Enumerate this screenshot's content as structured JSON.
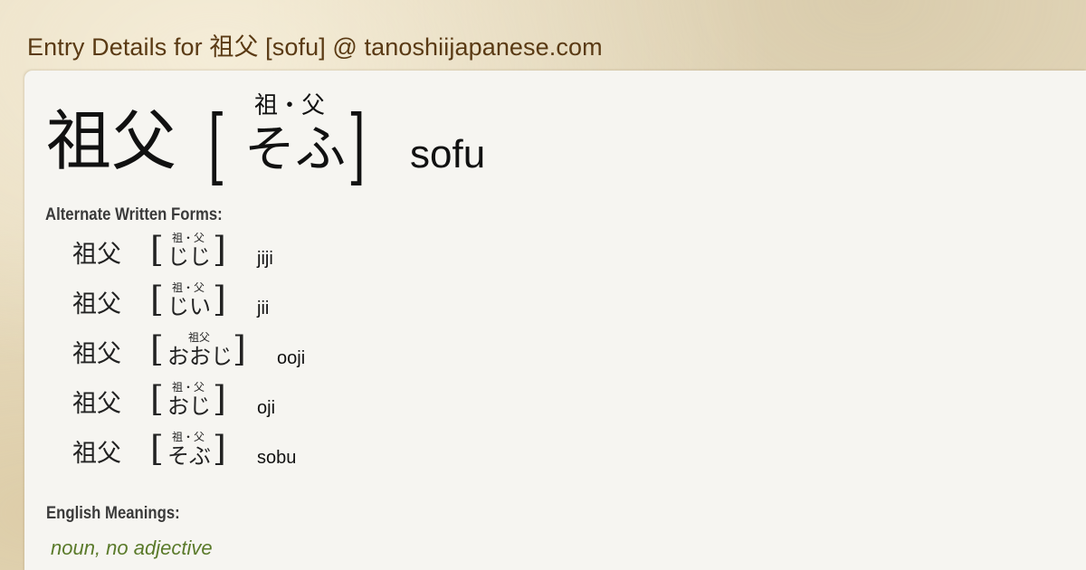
{
  "header": {
    "title": "Entry Details for 祖父 [sofu] @ tanoshiijapanese.com"
  },
  "entry": {
    "kanji": "祖父",
    "furigana": "祖・父",
    "kana": "そふ",
    "romaji": "sofu",
    "bracket_open": "[",
    "bracket_close": "]"
  },
  "alternates": {
    "label": "Alternate Written Forms:",
    "items": [
      {
        "kanji": "祖父",
        "furigana": "祖・父",
        "kana": "じじ",
        "romaji": "jiji"
      },
      {
        "kanji": "祖父",
        "furigana": "祖・父",
        "kana": "じい",
        "romaji": "jii"
      },
      {
        "kanji": "祖父",
        "furigana": "祖父",
        "kana": "おおじ",
        "romaji": "ooji"
      },
      {
        "kanji": "祖父",
        "furigana": "祖・父",
        "kana": "おじ",
        "romaji": "oji"
      },
      {
        "kanji": "祖父",
        "furigana": "祖・父",
        "kana": "そぶ",
        "romaji": "sobu"
      }
    ]
  },
  "meanings": {
    "label": "English Meanings:",
    "part_of_speech": "noun, no adjective"
  },
  "colors": {
    "title": "#5a3a14",
    "panel": "#f6f5f1",
    "background": "#e8dcc0",
    "meaning": "#5a7a2a"
  }
}
